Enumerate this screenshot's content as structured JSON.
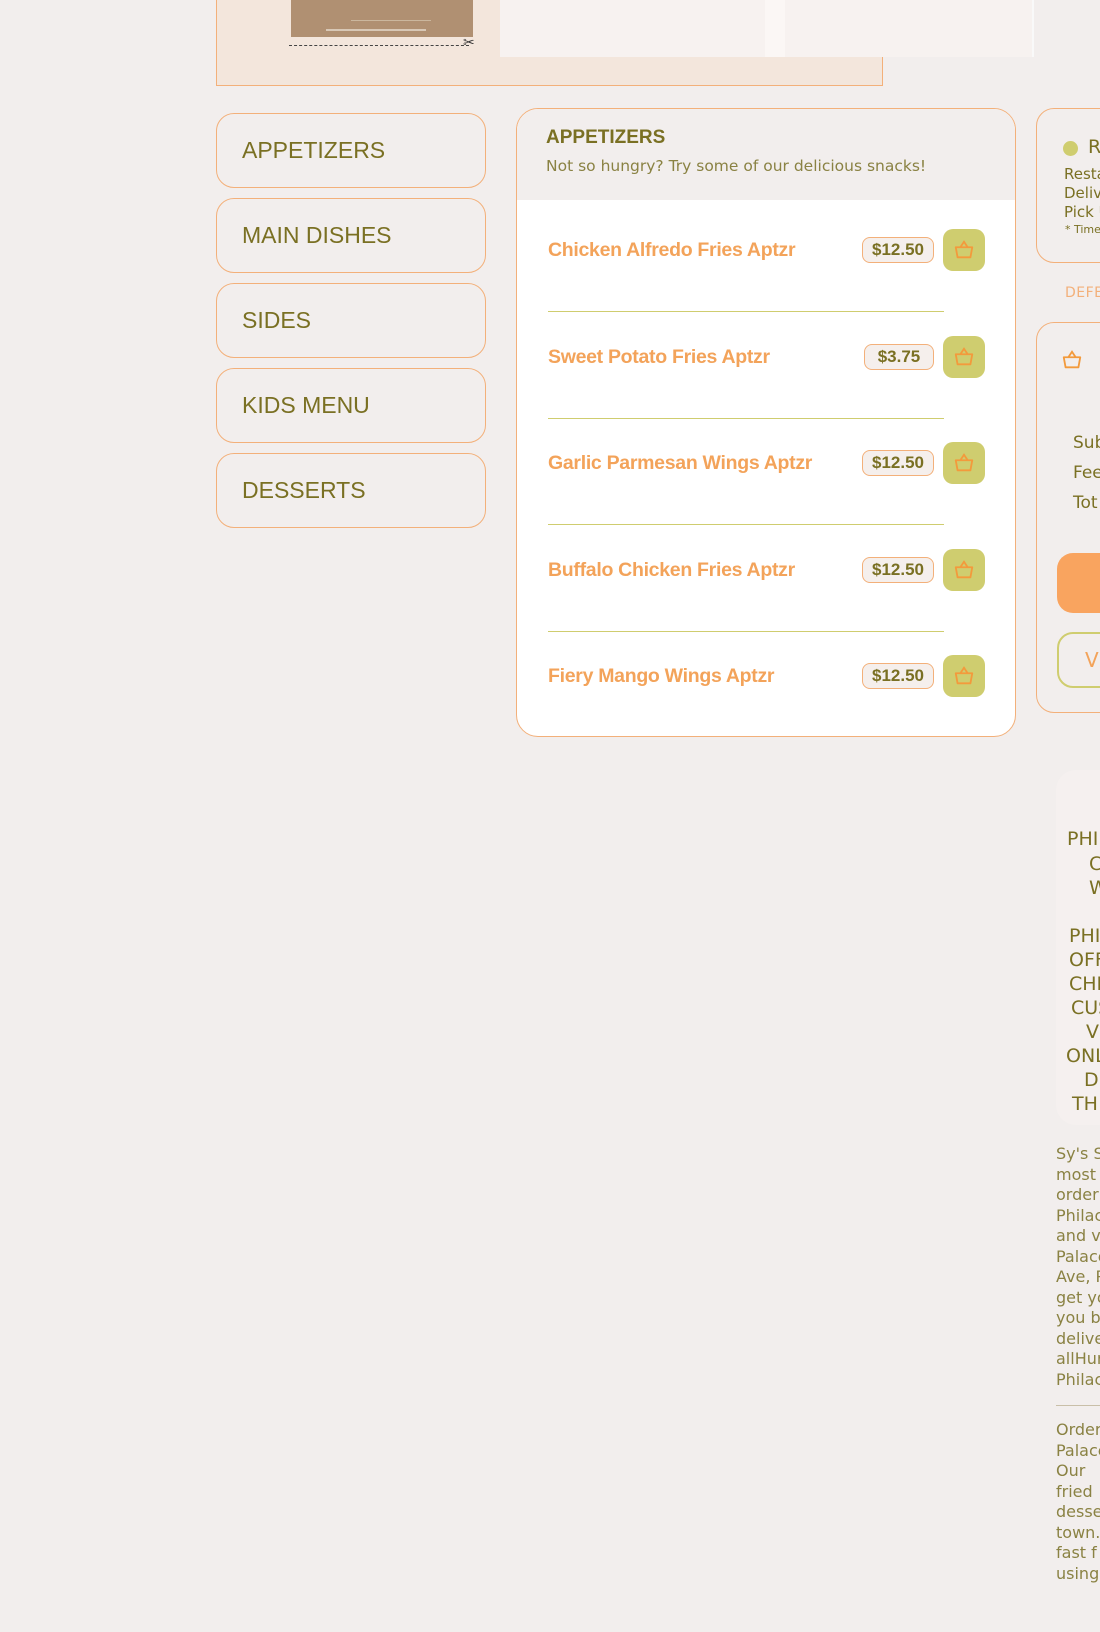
{
  "categories": [
    "APPETIZERS",
    "MAIN DISHES",
    "SIDES",
    "KIDS MENU",
    "DESSERTS"
  ],
  "menu": {
    "title": "APPETIZERS",
    "subtitle": "Not so hungry? Try some of our delicious snacks!",
    "items": [
      {
        "name": "Chicken Alfredo Fries Aptzr",
        "price": "$12.50"
      },
      {
        "name": "Sweet Potato Fries Aptzr",
        "price": "$3.75"
      },
      {
        "name": "Garlic Parmesan Wings Aptzr",
        "price": "$12.50"
      },
      {
        "name": "Buffalo Chicken Fries Aptzr",
        "price": "$12.50"
      },
      {
        "name": "Fiery Mango Wings Aptzr",
        "price": "$12.50"
      }
    ]
  },
  "status": {
    "letter": "R",
    "lines": [
      "Resta",
      "Deliv",
      "Pick U"
    ],
    "note": "* Time"
  },
  "defer_label": "DEFE",
  "cart": {
    "rows": [
      "Sub",
      "Fee",
      "Tot"
    ],
    "view_label": "Vi"
  },
  "promo_lines": [
    "PHI",
    "C",
    "W",
    "",
    "PHI",
    "OFF",
    "CHI",
    "CUS",
    "V",
    "ONL",
    "DI",
    "TH"
  ],
  "about_1": "Sy's S\nmost \norder \nPhilac\nand vi\nPalace\nAve, P\nget yo\nyou b\ndelive\nallHur\nPhilac",
  "about_2": "Order\nPalace\nOur \nfried \ndesse\ntown.\nfast f\nusing",
  "colors": {
    "accent": "#f3a35a",
    "olive": "#7a7023",
    "green": "#cfcd6f",
    "border": "#f3b07a"
  },
  "icons": {
    "cart": "basket-icon",
    "cut": "scissors-icon"
  }
}
